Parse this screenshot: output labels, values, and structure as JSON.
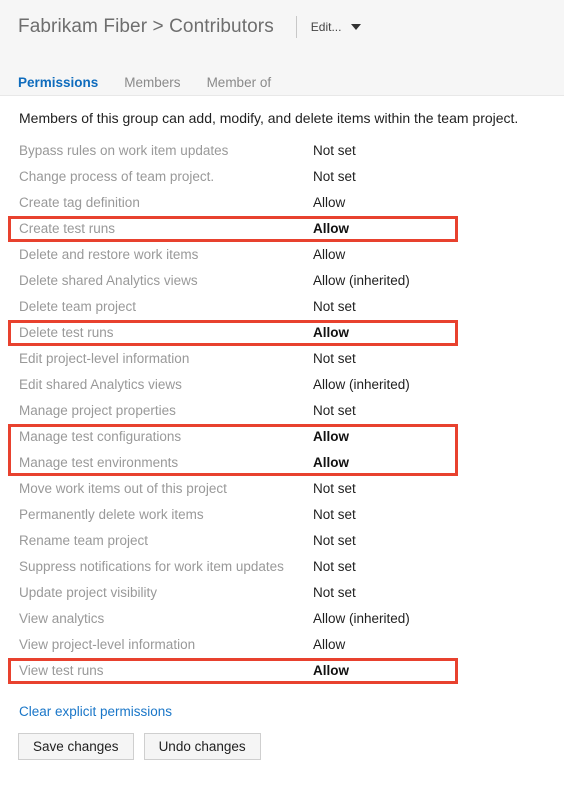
{
  "header": {
    "breadcrumb": "Fabrikam Fiber > Contributors",
    "edit_label": "Edit...",
    "caret_icon": "chevron-down-icon",
    "divider_icon": "vertical-divider"
  },
  "tabs": [
    {
      "label": "Permissions",
      "active": true
    },
    {
      "label": "Members",
      "active": false
    },
    {
      "label": "Member of",
      "active": false
    }
  ],
  "description": "Members of this group can add, modify, and delete items within the team project.",
  "permissions": [
    {
      "name": "Bypass rules on work item updates",
      "value": "Not set",
      "highlighted": false
    },
    {
      "name": "Change process of team project.",
      "value": "Not set",
      "highlighted": false
    },
    {
      "name": "Create tag definition",
      "value": "Allow",
      "highlighted": false
    },
    {
      "name": "Create test runs",
      "value": "Allow",
      "highlighted": true
    },
    {
      "name": "Delete and restore work items",
      "value": "Allow",
      "highlighted": false
    },
    {
      "name": "Delete shared Analytics views",
      "value": "Allow (inherited)",
      "highlighted": false
    },
    {
      "name": "Delete team project",
      "value": "Not set",
      "highlighted": false
    },
    {
      "name": "Delete test runs",
      "value": "Allow",
      "highlighted": true
    },
    {
      "name": "Edit project-level information",
      "value": "Not set",
      "highlighted": false
    },
    {
      "name": "Edit shared Analytics views",
      "value": "Allow (inherited)",
      "highlighted": false
    },
    {
      "name": "Manage project properties",
      "value": "Not set",
      "highlighted": false
    },
    {
      "name": "Manage test configurations",
      "value": "Allow",
      "highlighted": true
    },
    {
      "name": "Manage test environments",
      "value": "Allow",
      "highlighted": true
    },
    {
      "name": "Move work items out of this project",
      "value": "Not set",
      "highlighted": false
    },
    {
      "name": "Permanently delete work items",
      "value": "Not set",
      "highlighted": false
    },
    {
      "name": "Rename team project",
      "value": "Not set",
      "highlighted": false
    },
    {
      "name": "Suppress notifications for work item updates",
      "value": "Not set",
      "highlighted": false
    },
    {
      "name": "Update project visibility",
      "value": "Not set",
      "highlighted": false
    },
    {
      "name": "View analytics",
      "value": "Allow (inherited)",
      "highlighted": false
    },
    {
      "name": "View project-level information",
      "value": "Allow",
      "highlighted": false
    },
    {
      "name": "View test runs",
      "value": "Allow",
      "highlighted": true
    }
  ],
  "highlight_groups": [
    {
      "start_index": 3,
      "end_index": 3
    },
    {
      "start_index": 7,
      "end_index": 7
    },
    {
      "start_index": 11,
      "end_index": 12
    },
    {
      "start_index": 20,
      "end_index": 20
    }
  ],
  "footer": {
    "clear_link": "Clear explicit permissions",
    "save_label": "Save changes",
    "undo_label": "Undo changes"
  },
  "colors": {
    "accent_blue": "#0f6cbd",
    "link_blue": "#1976c8",
    "highlight_red": "#e8412e",
    "header_bg": "#f6f6f6",
    "label_gray": "#999999",
    "value_dark": "#1f1f1f"
  }
}
